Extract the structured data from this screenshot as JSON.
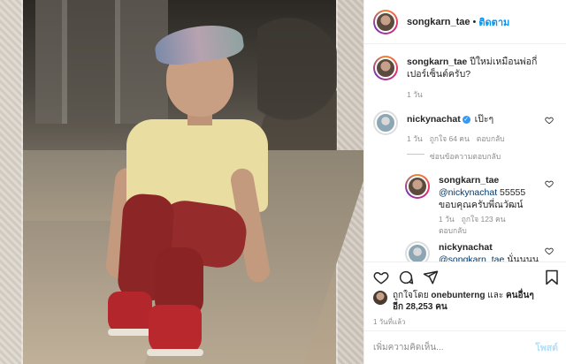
{
  "post": {
    "author": "songkarn_tae",
    "follow_label": "ติดตาม",
    "dot": "•"
  },
  "caption": {
    "username": "songkarn_tae",
    "text": "ปีใหม่เหมือนพ่อกี่เปอร์เซ็นต์ครับ?",
    "time": "1 วัน"
  },
  "comments": [
    {
      "username": "nickynachat",
      "verified": true,
      "text": "เป๊ะๆ",
      "time": "1 วัน",
      "likes": "ถูกใจ 64 คน",
      "reply_label": "ตอบกลับ"
    }
  ],
  "hide_replies": "ซ่อนข้อความตอบกลับ",
  "replies": [
    {
      "username": "songkarn_tae",
      "mention": "@nickynachat",
      "text": "55555 ขอบคุณครับพี่ณวัฒน์",
      "time": "1 วัน",
      "likes": "ถูกใจ 123 คน",
      "reply_label": "ตอบกลับ"
    },
    {
      "username": "nickynachat",
      "mention": "@songkarn_tae",
      "text": "นั่นนนน"
    }
  ],
  "likes_summary": {
    "prefix": "ถูกใจโดย",
    "first_user": "onebunterng",
    "and": "และ",
    "others": "คนอื่นๆ อีก 28,253 คน"
  },
  "post_time": "1 วันที่แล้ว",
  "add_comment": {
    "placeholder": "เพิ่มความคิดเห็น...",
    "post_label": "โพสต์"
  },
  "icons": {
    "like": "heart-icon",
    "comment": "comment-icon",
    "share": "share-icon",
    "save": "bookmark-icon"
  }
}
